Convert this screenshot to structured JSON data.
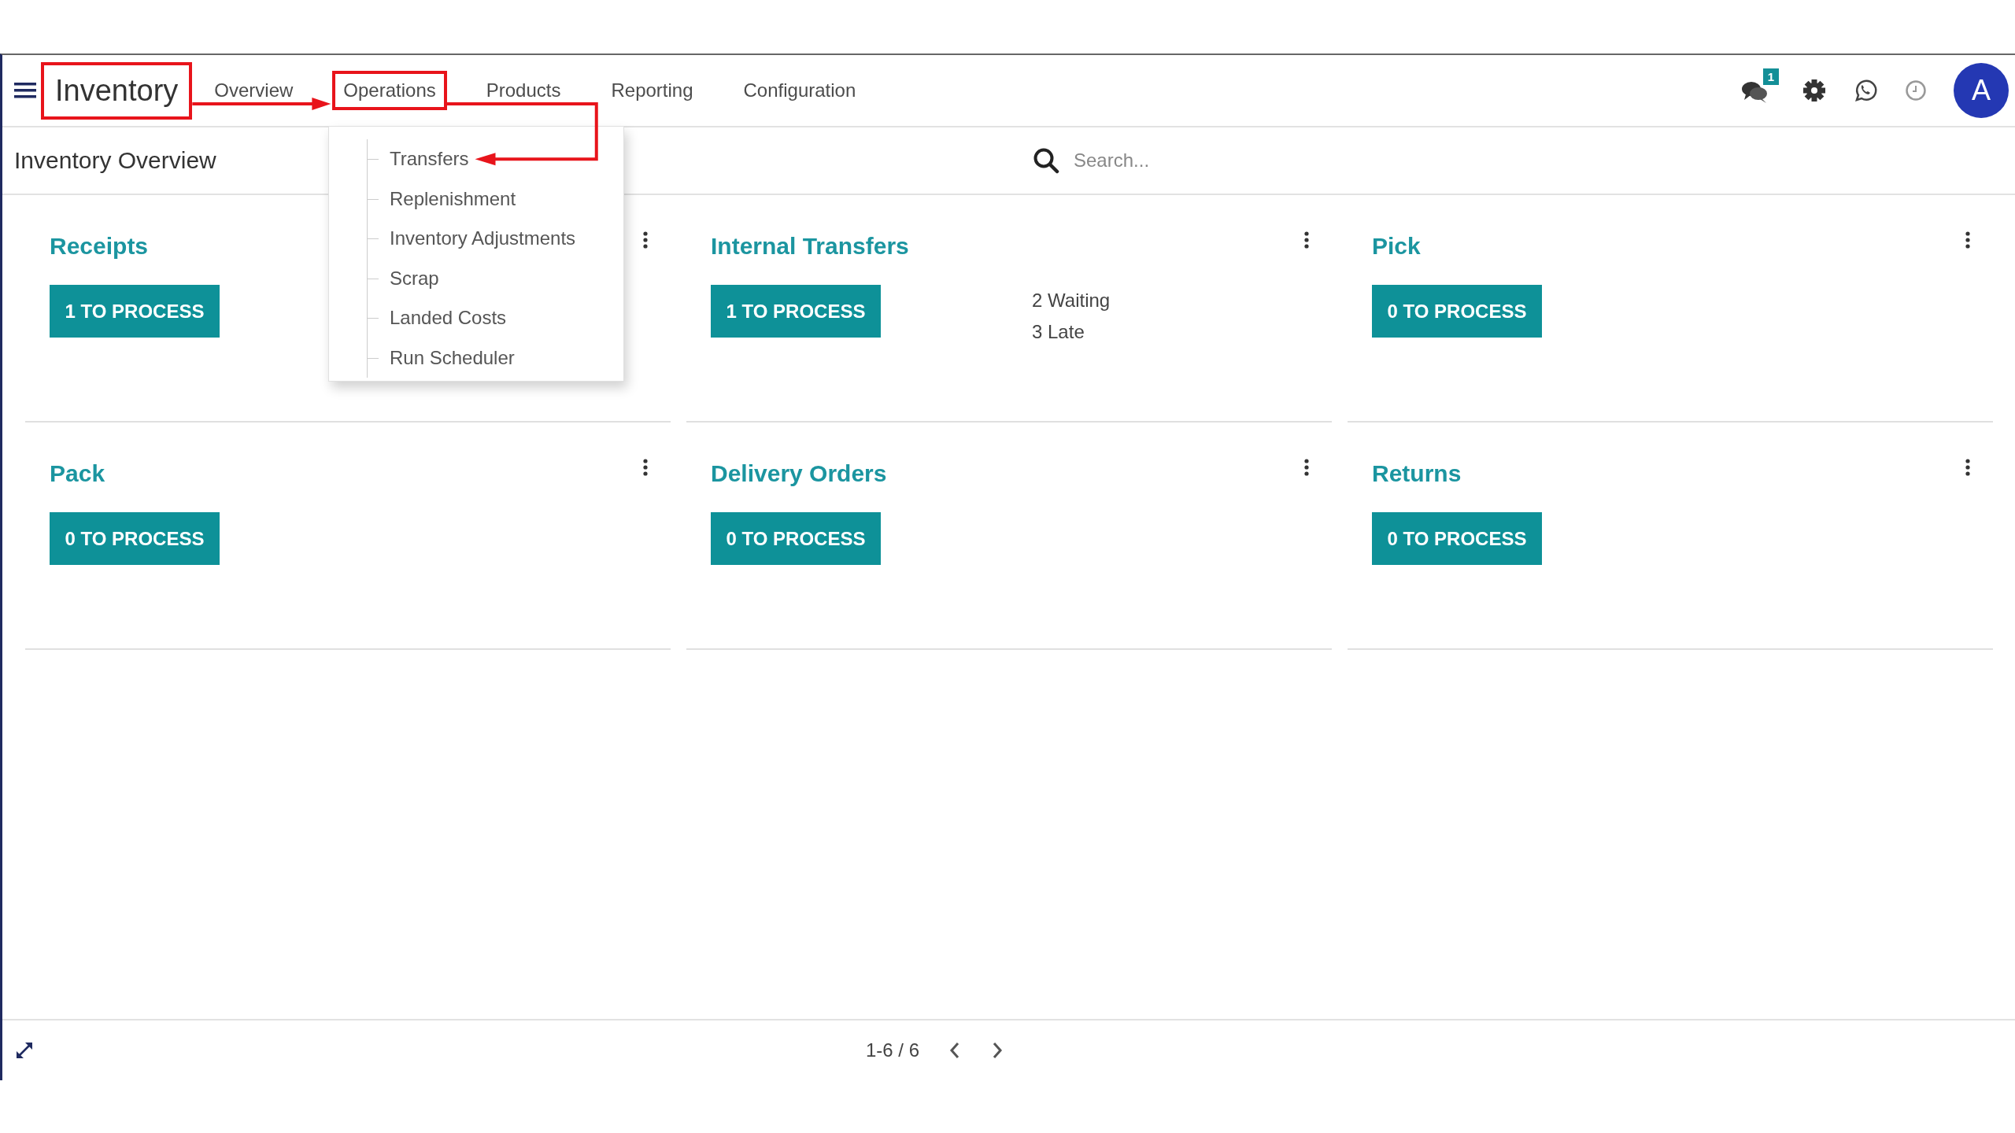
{
  "navbar": {
    "brand": {
      "label": "Inventory",
      "highlighted": true
    },
    "menu": [
      {
        "label": "Overview",
        "highlighted": false
      },
      {
        "label": "Operations",
        "highlighted": true
      },
      {
        "label": "Products",
        "highlighted": false
      },
      {
        "label": "Reporting",
        "highlighted": false
      },
      {
        "label": "Configuration",
        "highlighted": false
      }
    ],
    "messages_badge": "1",
    "avatar": "A"
  },
  "operations_menu": {
    "items": [
      {
        "label": "Transfers",
        "pointed_at": true
      },
      {
        "label": "Replenishment",
        "pointed_at": false
      },
      {
        "label": "Inventory Adjustments",
        "pointed_at": false
      },
      {
        "label": "Scrap",
        "pointed_at": false
      },
      {
        "label": "Landed Costs",
        "pointed_at": false
      },
      {
        "label": "Run Scheduler",
        "pointed_at": false
      }
    ]
  },
  "control_panel": {
    "title": "Inventory Overview",
    "search": {
      "placeholder": "Search..."
    }
  },
  "cards": [
    {
      "title": "Receipts",
      "button": "1 TO PROCESS"
    },
    {
      "title": "Internal Transfers",
      "button": "1 TO PROCESS",
      "links": [
        "2 Waiting",
        "3 Late"
      ]
    },
    {
      "title": "Pick",
      "button": "0 TO PROCESS"
    },
    {
      "title": "Pack",
      "button": "0 TO PROCESS"
    },
    {
      "title": "Delivery Orders",
      "button": "0 TO PROCESS"
    },
    {
      "title": "Returns",
      "button": "0 TO PROCESS"
    }
  ],
  "pager": {
    "range": "1-6 / 6"
  }
}
